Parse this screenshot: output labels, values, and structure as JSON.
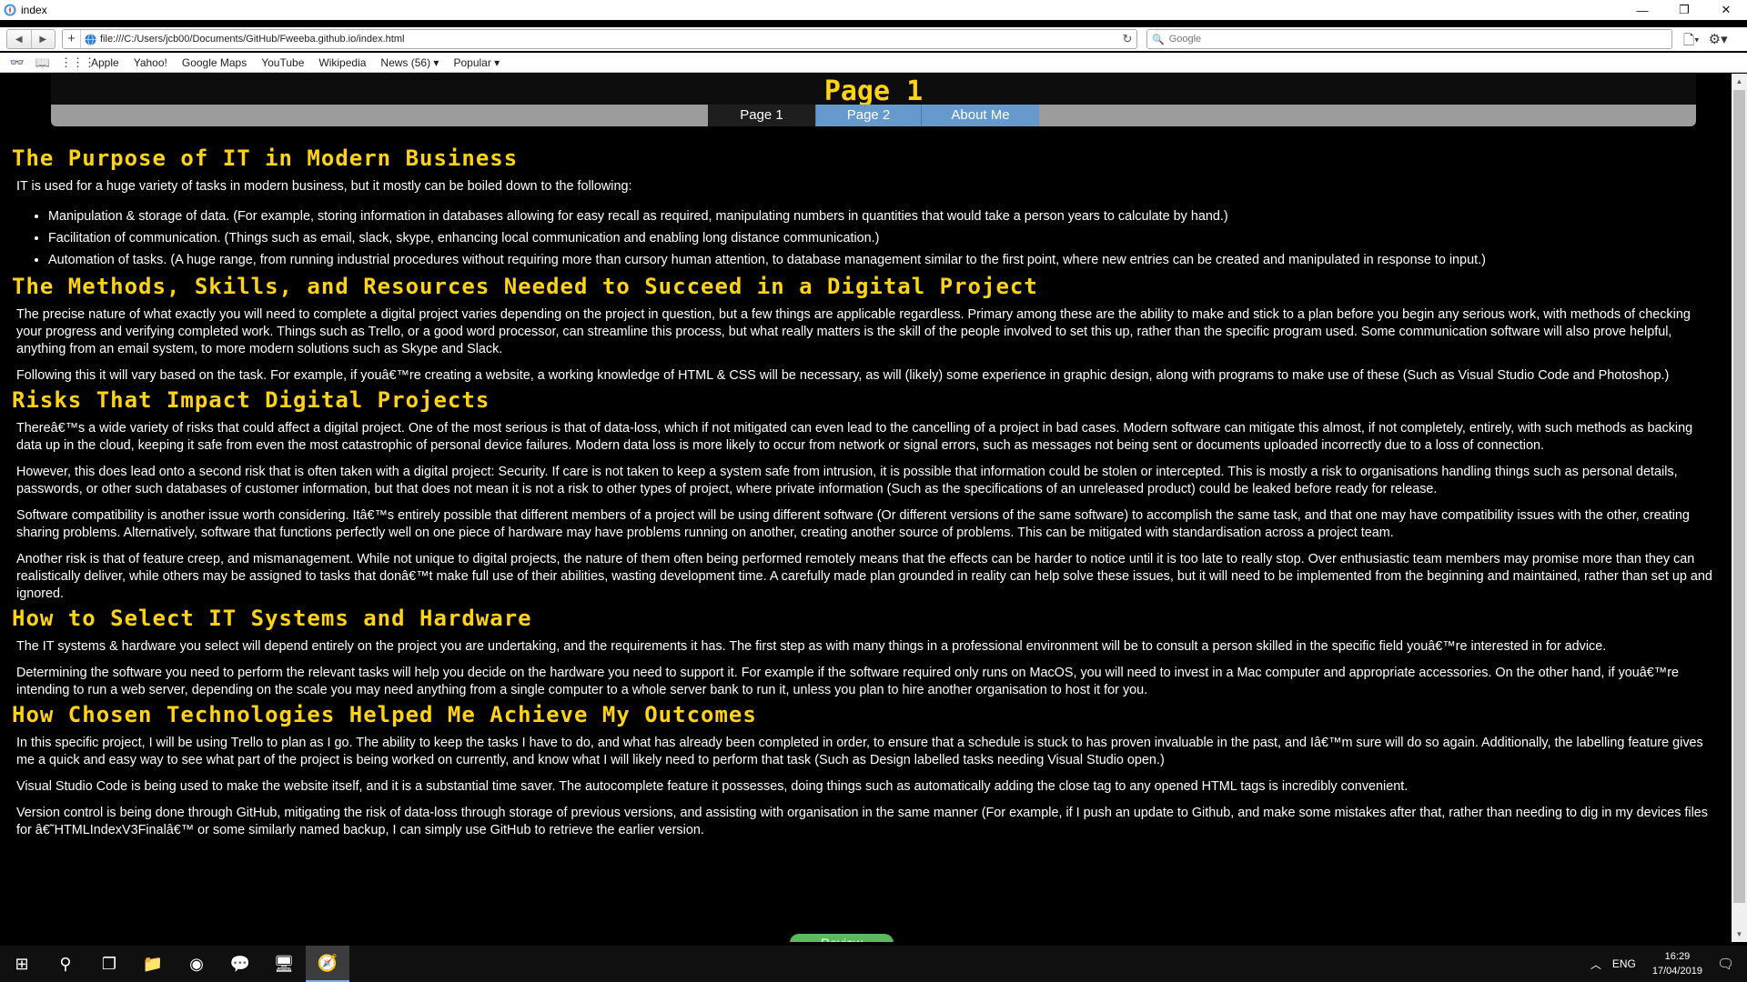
{
  "window": {
    "title": "index",
    "controls": [
      "—",
      "❐",
      "✕"
    ]
  },
  "toolbar": {
    "back": "◀",
    "forward": "▶",
    "new_tab": "+",
    "url": "file:///C:/Users/jcb00/Documents/GitHub/Fweeba.github.io/index.html",
    "reload": "↻",
    "search_placeholder": "Google",
    "search_icon": "🔍",
    "page_menu": "🗋▾",
    "settings_menu": "⚙▾"
  },
  "bookmarks": {
    "icons": [
      "👓",
      "📖",
      "⋮⋮⋮"
    ],
    "items": [
      "Apple",
      "Yahoo!",
      "Google Maps",
      "YouTube",
      "Wikipedia",
      "News (56) ▾",
      "Popular ▾"
    ]
  },
  "page": {
    "heading": "Page 1",
    "tabs": [
      "Page 1",
      "Page 2",
      "About Me"
    ],
    "sections": [
      {
        "title": "The Purpose of IT in Modern Business",
        "intro": "IT is used for a huge variety of tasks in modern business, but it mostly can be boiled down to the following:",
        "bullets": [
          "Manipulation & storage of data. (For example, storing information in databases allowing for easy recall as required, manipulating numbers in quantities that would take a person years to calculate by hand.)",
          "Facilitation of communication. (Things such as email, slack, skype, enhancing local communication and enabling long distance communication.)",
          "Automation of tasks. (A huge range, from running industrial procedures without requiring more than cursory human attention, to database management similar to the first point, where new entries can be created and manipulated in response to input.)"
        ]
      },
      {
        "title": "The Methods, Skills, and Resources Needed to Succeed in a Digital Project",
        "paragraphs": [
          "The precise nature of what exactly you will need to complete a digital project varies depending on the project in question, but a few things are applicable regardless. Primary among these are the ability to make and stick to a plan before you begin any serious work, with methods of checking your progress and verifying completed work. Things such as Trello, or a good word processor, can streamline this process, but what really matters is the skill of the people involved to set this up, rather than the specific program used. Some communication software will also prove helpful, anything from an email system, to more modern solutions such as Skype and Slack.",
          "Following this it will vary based on the task. For example, if youâ€™re creating a website, a working knowledge of HTML & CSS will be necessary, as will (likely) some experience in graphic design, along with programs to make use of these (Such as Visual Studio Code and Photoshop.)"
        ]
      },
      {
        "title": "Risks That Impact Digital Projects",
        "paragraphs": [
          "Thereâ€™s a wide variety of risks that could affect a digital project. One of the most serious is that of data-loss, which if not mitigated can even lead to the cancelling of a project in bad cases. Modern software can mitigate this almost, if not completely, entirely, with such methods as backing data up in the cloud, keeping it safe from even the most catastrophic of personal device failures. Modern data loss is more likely to occur from network or signal errors, such as messages not being sent or documents uploaded incorrectly due to a loss of connection.",
          "However, this does lead onto a second risk that is often taken with a digital project: Security. If care is not taken to keep a system safe from intrusion, it is possible that information could be stolen or intercepted. This is mostly a risk to organisations handling things such as personal details, passwords, or other such databases of customer information, but that does not mean it is not a risk to other types of project, where private information (Such as the specifications of an unreleased product) could be leaked before ready for release.",
          "Software compatibility is another issue worth considering. Itâ€™s entirely possible that different members of a project will be using different software (Or different versions of the same software) to accomplish the same task, and that one may have compatibility issues with the other, creating sharing problems. Alternatively, software that functions perfectly well on one piece of hardware may have problems running on another, creating another source of problems. This can be mitigated with standardisation across a project team.",
          "Another risk is that of feature creep, and mismanagement. While not unique to digital projects, the nature of them often being performed remotely means that the effects can be harder to notice until it is too late to really stop. Over enthusiastic team members may promise more than they can realistically deliver, while others may be assigned to tasks that donâ€™t make full use of their abilities, wasting development time. A carefully made plan grounded in reality can help solve these issues, but it will need to be implemented from the beginning and maintained, rather than set up and ignored."
        ]
      },
      {
        "title": "How to Select IT Systems and Hardware",
        "paragraphs": [
          "The IT systems & hardware you select will depend entirely on the project you are undertaking, and the requirements it has. The first step as with many things in a professional environment will be to consult a person skilled in the specific field youâ€™re interested in for advice.",
          "Determining the software you need to perform the relevant tasks will help you decide on the hardware you need to support it. For example if the software required only runs on MacOS, you will need to invest in a Mac computer and appropriate accessories. On the other hand, if youâ€™re intending to run a web server, depending on the scale you may need anything from a single computer to a whole server bank to run it, unless you plan to hire another organisation to host it for you."
        ]
      },
      {
        "title": "How Chosen Technologies Helped Me Achieve My Outcomes",
        "paragraphs": [
          "In this specific project, I will be using Trello to plan as I go. The ability to keep the tasks I have to do, and what has already been completed in order, to ensure that a schedule is stuck to has proven invaluable in the past, and Iâ€™m sure will do so again. Additionally, the labelling feature gives me a quick and easy way to see what part of the project is being worked on currently, and know what I will likely need to perform that task (Such as Design labelled tasks needing Visual Studio open.)",
          "Visual Studio Code is being used to make the website itself, and it is a substantial time saver. The autocomplete feature it possesses, doing things such as automatically adding the close tag to any opened HTML tags is incredibly convenient.",
          "Version control is being done through GitHub, mitigating the risk of data-loss through storage of previous versions, and assisting with organisation in the same manner (For example, if I push an update to Github, and make some mistakes after that, rather than needing to dig in my devices files for â€˜HTMLIndexV3Finalâ€™ or some similarly named backup, I can simply use GitHub to retrieve the earlier version."
        ]
      }
    ],
    "review_button": "Review"
  },
  "taskbar": {
    "start": "⊞",
    "search": "⚲",
    "task_view": "❐",
    "apps": [
      "📁",
      "◉",
      "💬",
      "🖥",
      "🧭"
    ],
    "tray_arrow": "︿",
    "language": "ENG",
    "time": "16:29",
    "date": "17/04/2019",
    "notifications": "🗨"
  }
}
